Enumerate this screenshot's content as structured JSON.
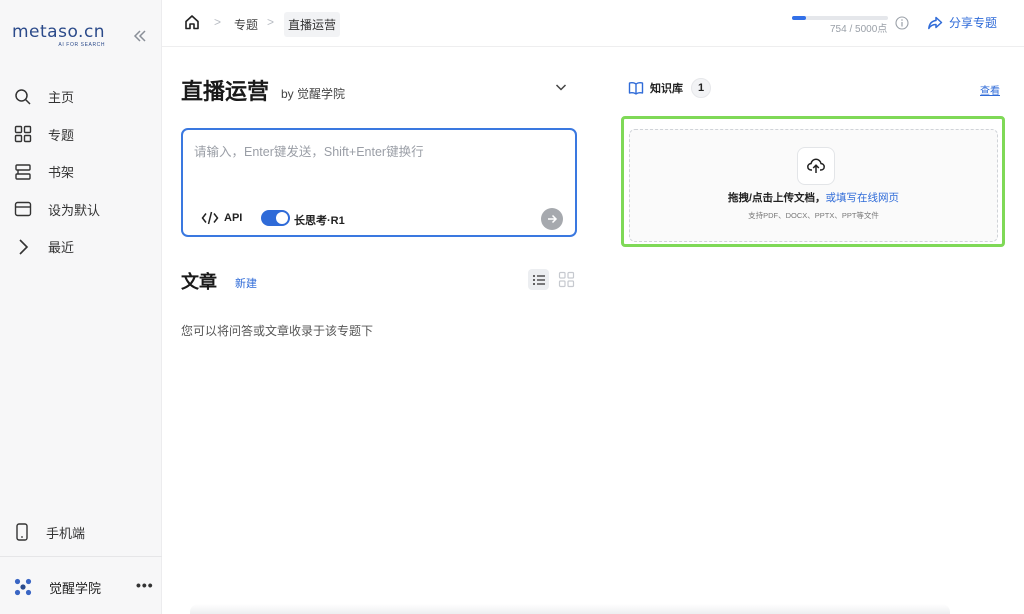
{
  "brand": {
    "logo": "metaso.cn",
    "tagline": "AI FOR SEARCH"
  },
  "sidebar": {
    "items": [
      {
        "label": "主页",
        "icon": "search-icon"
      },
      {
        "label": "专题",
        "icon": "grid-icon"
      },
      {
        "label": "书架",
        "icon": "bookshelf-icon"
      },
      {
        "label": "设为默认",
        "icon": "window-icon"
      },
      {
        "label": "最近",
        "icon": "chevron-right-icon"
      }
    ],
    "mobile": "手机端",
    "user": "觉醒学院",
    "more": "•••"
  },
  "breadcrumb": {
    "section": "专题",
    "current": "直播运营",
    "separator": ">"
  },
  "quota": {
    "text": "754 / 5000点",
    "used": 754,
    "total": 5000
  },
  "share": "分享专题",
  "topic": {
    "title": "直播运营",
    "by": "by 觉醒学院"
  },
  "composer": {
    "placeholder": "请输入，Enter键发送，Shift+Enter键换行",
    "api": "API",
    "mode": "长思考·R1",
    "mode_enabled": true
  },
  "articles": {
    "title": "文章",
    "new": "新建",
    "empty": "您可以将问答或文章收录于该专题下"
  },
  "knowledge": {
    "title": "知识库",
    "count": "1",
    "view": "查看",
    "upload_main": "拖拽/点击上传文档，",
    "upload_link": "或填写在线网页",
    "upload_hint": "支持PDF、DOCX、PPTX、PPT等文件"
  },
  "colors": {
    "accent": "#2f6bd8",
    "highlight": "#7fd957",
    "brand": "#2b4a8a"
  }
}
